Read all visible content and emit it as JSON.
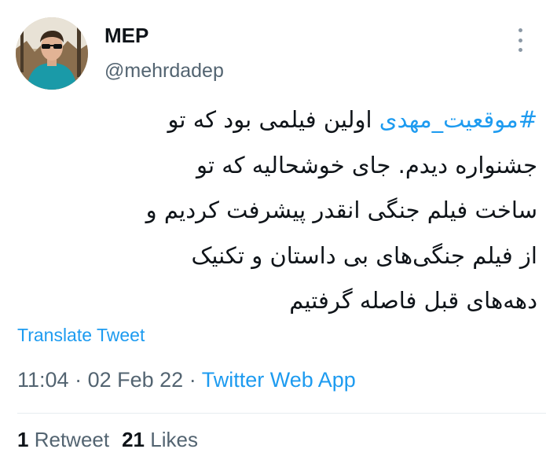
{
  "tweet": {
    "author": {
      "name": "MEP",
      "handle": "@mehrdadep"
    },
    "text_lines": [
      {
        "hashtag": "#موقعیت_مهدی",
        "text": " اولین فیلمی بود که تو"
      },
      {
        "hashtag": "",
        "text": "جشنواره دیدم. جای خوشحالیه که تو"
      },
      {
        "hashtag": "",
        "text": "ساخت فیلم جنگی انقدر پیشرفت کردیم و"
      },
      {
        "hashtag": "",
        "text": "از فیلم جنگی‌های بی داستان و تکنیک"
      },
      {
        "hashtag": "",
        "text": "دهه‌های قبل فاصله گرفتیم"
      }
    ],
    "translate_label": "Translate Tweet",
    "time": "11:04",
    "date": "02 Feb 22",
    "separator": "·",
    "source": "Twitter Web App",
    "retweets": {
      "count": "1",
      "label": "Retweet"
    },
    "likes": {
      "count": "21",
      "label": "Likes"
    }
  },
  "icons": {
    "more": "more-vertical-icon"
  },
  "colors": {
    "link": "#1d9bf0",
    "secondary": "#536471",
    "text": "#0f1419"
  }
}
